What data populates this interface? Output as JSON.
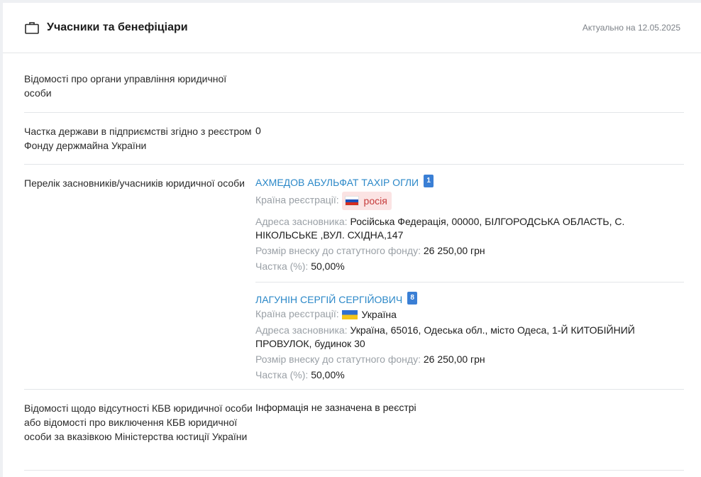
{
  "header": {
    "title": "Учасники та бенефіціари",
    "date": "Актуально на 12.05.2025",
    "icon": "briefcase-icon"
  },
  "rows": [
    {
      "label": "Відомості про органи управління юридичної особи",
      "value": ""
    },
    {
      "label": "Частка держави в підприємстві згідно з реєстром Фонду держмайна України",
      "value": "0"
    },
    {
      "label": "Перелік засновників/учасників юридичної особи"
    },
    {
      "label": "Відомості щодо відсутності КБВ юридичної особи або відомості про виключення КБВ юридичної особи за вказівкою Міністерства юстиції України",
      "value": "Інформація не зазначена в реєстрі"
    }
  ],
  "founders": [
    {
      "name": "АХМЕДОВ АБУЛЬФАТ ТАХІР ОГЛИ",
      "badge": "1",
      "country_label": "Країна реєстрації:",
      "country": "росія",
      "address_label": "Адреса засновника:",
      "address": "Російська Федерація, 00000, БІЛГОРОДСЬКА ОБЛАСТЬ, С. НІКОЛЬСЬКЕ ,ВУЛ. СХІДНА,147",
      "contribution_label": "Розмір внеску до статутного фонду:",
      "contribution": "26 250,00 грн",
      "share_label": "Частка (%):",
      "share": "50,00%"
    },
    {
      "name": "ЛАГУНІН СЕРГІЙ СЕРГІЙОВИЧ",
      "badge": "8",
      "country_label": "Країна реєстрації:",
      "country": "Україна",
      "address_label": "Адреса засновника:",
      "address": "Україна, 65016, Одеська обл., місто Одеса, 1-Й КИТОБІЙНИЙ ПРОВУЛОК, будинок 30",
      "contribution_label": "Розмір внеску до статутного фонду:",
      "contribution": "26 250,00 грн",
      "share_label": "Частка (%):",
      "share": "50,00%"
    }
  ],
  "colors": {
    "link": "#2b88c8",
    "badge": "#3a7fd5",
    "muted": "#9aa0a6",
    "russia_pill_bg": "#fbe3e3",
    "russia_pill_text": "#c63b3b"
  }
}
